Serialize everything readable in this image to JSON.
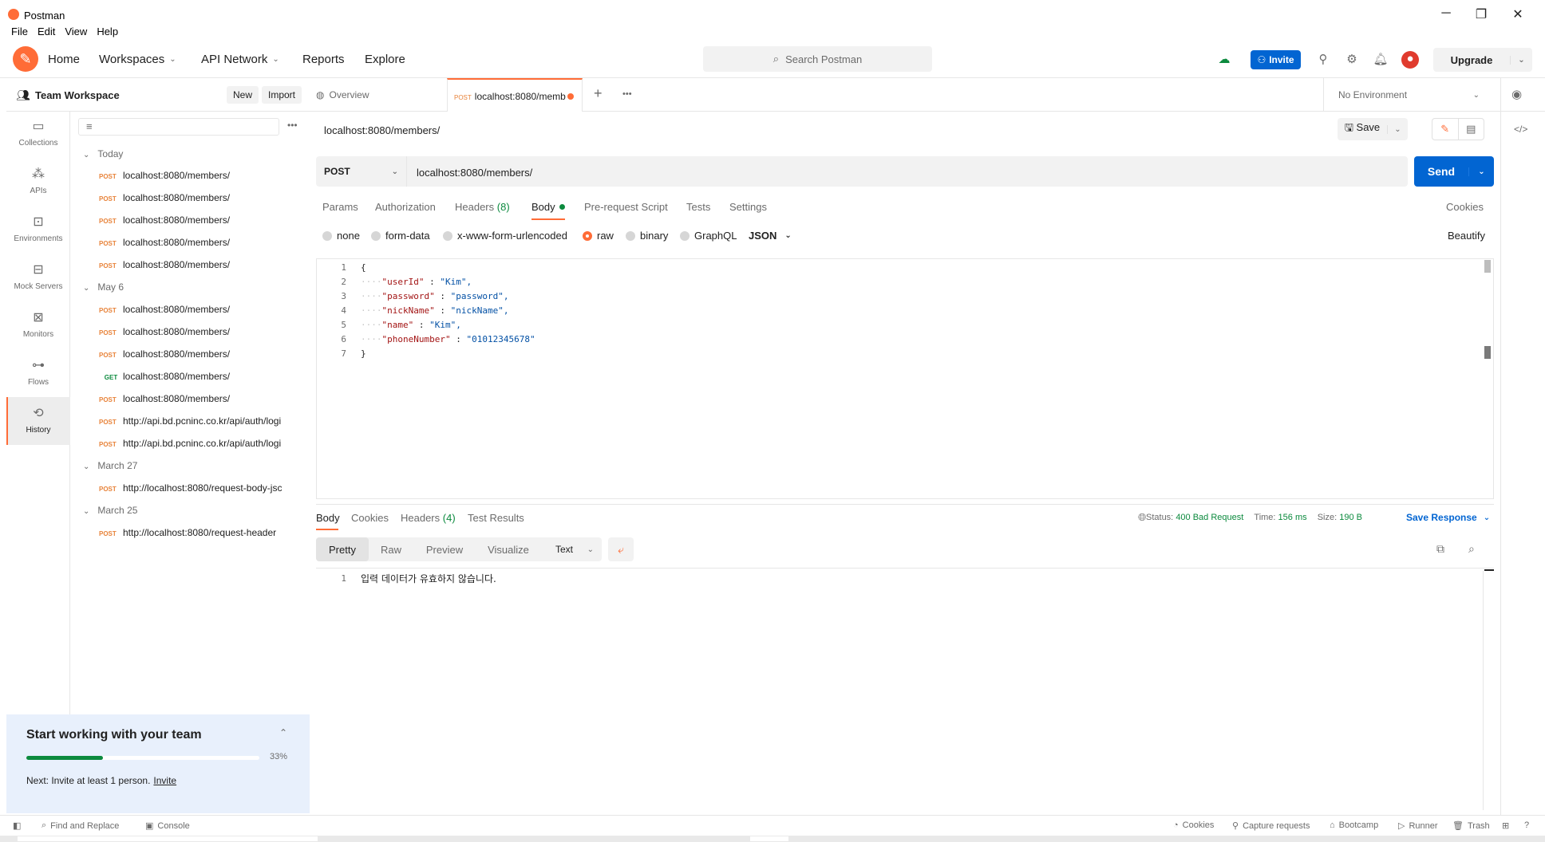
{
  "window": {
    "title": "Postman",
    "menu": [
      "File",
      "Edit",
      "View",
      "Help"
    ]
  },
  "header": {
    "nav": [
      "Home",
      "Workspaces",
      "API Network",
      "Reports",
      "Explore"
    ],
    "search_placeholder": "Search Postman",
    "invite_label": "Invite",
    "upgrade_label": "Upgrade"
  },
  "workspace": {
    "title": "Team Workspace",
    "new_label": "New",
    "import_label": "Import"
  },
  "sidebar": {
    "items": [
      "Collections",
      "APIs",
      "Environments",
      "Mock Servers",
      "Monitors",
      "Flows",
      "History"
    ],
    "active": "History"
  },
  "history": [
    {
      "group": "Today",
      "items": [
        {
          "method": "POST",
          "url": "localhost:8080/members/"
        },
        {
          "method": "POST",
          "url": "localhost:8080/members/"
        },
        {
          "method": "POST",
          "url": "localhost:8080/members/"
        },
        {
          "method": "POST",
          "url": "localhost:8080/members/"
        },
        {
          "method": "POST",
          "url": "localhost:8080/members/"
        }
      ]
    },
    {
      "group": "May 6",
      "items": [
        {
          "method": "POST",
          "url": "localhost:8080/members/"
        },
        {
          "method": "POST",
          "url": "localhost:8080/members/"
        },
        {
          "method": "POST",
          "url": "localhost:8080/members/"
        },
        {
          "method": "GET",
          "url": "localhost:8080/members/"
        },
        {
          "method": "POST",
          "url": "localhost:8080/members/"
        },
        {
          "method": "POST",
          "url": "http://api.bd.pcninc.co.kr/api/auth/logi"
        },
        {
          "method": "POST",
          "url": "http://api.bd.pcninc.co.kr/api/auth/logi"
        }
      ]
    },
    {
      "group": "March 27",
      "items": [
        {
          "method": "POST",
          "url": "http://localhost:8080/request-body-jsc"
        }
      ]
    },
    {
      "group": "March 25",
      "items": [
        {
          "method": "POST",
          "url": "http://localhost:8080/request-header"
        }
      ]
    }
  ],
  "team_card": {
    "title": "Start working with your team",
    "progress": 33,
    "progress_label": "33%",
    "next_text": "Next: Invite at least 1 person.",
    "next_link": "Invite"
  },
  "tabs": {
    "overview": "Overview",
    "active_method": "POST",
    "active_url": "localhost:8080/memb",
    "environment": "No Environment"
  },
  "request": {
    "name": "localhost:8080/members/",
    "method": "POST",
    "url": "localhost:8080/members/",
    "save_label": "Save",
    "send_label": "Send",
    "tabs": [
      "Params",
      "Authorization",
      "Headers",
      "Body",
      "Pre-request Script",
      "Tests",
      "Settings"
    ],
    "headers_count": "(8)",
    "cookies_label": "Cookies",
    "body_modes": [
      "none",
      "form-data",
      "x-www-form-urlencoded",
      "raw",
      "binary",
      "GraphQL"
    ],
    "body_format": "JSON",
    "beautify_label": "Beautify",
    "body_lines": [
      {
        "n": "1",
        "text": "{"
      },
      {
        "n": "2",
        "key": "\"userId\"",
        "value": "\"Kim\","
      },
      {
        "n": "3",
        "key": "\"password\"",
        "value": "\"password\","
      },
      {
        "n": "4",
        "key": "\"nickName\"",
        "value": "\"nickName\","
      },
      {
        "n": "5",
        "key": "\"name\"",
        "value": "\"Kim\","
      },
      {
        "n": "6",
        "key": "\"phoneNumber\"",
        "value": "\"01012345678\""
      },
      {
        "n": "7",
        "text": "}"
      }
    ]
  },
  "response": {
    "tabs": [
      "Body",
      "Cookies",
      "Headers",
      "Test Results"
    ],
    "headers_count": "(4)",
    "status_label": "Status:",
    "status_value": "400 Bad Request",
    "time_label": "Time:",
    "time_value": "156 ms",
    "size_label": "Size:",
    "size_value": "190 B",
    "save_label": "Save Response",
    "views": [
      "Pretty",
      "Raw",
      "Preview",
      "Visualize"
    ],
    "format": "Text",
    "line_no": "1",
    "line_text": "입력 데이터가 유효하지 않습니다."
  },
  "statusbar": {
    "left": [
      "Find and Replace",
      "Console"
    ],
    "right": [
      "Cookies",
      "Capture requests",
      "Bootcamp",
      "Runner",
      "Trash"
    ]
  }
}
